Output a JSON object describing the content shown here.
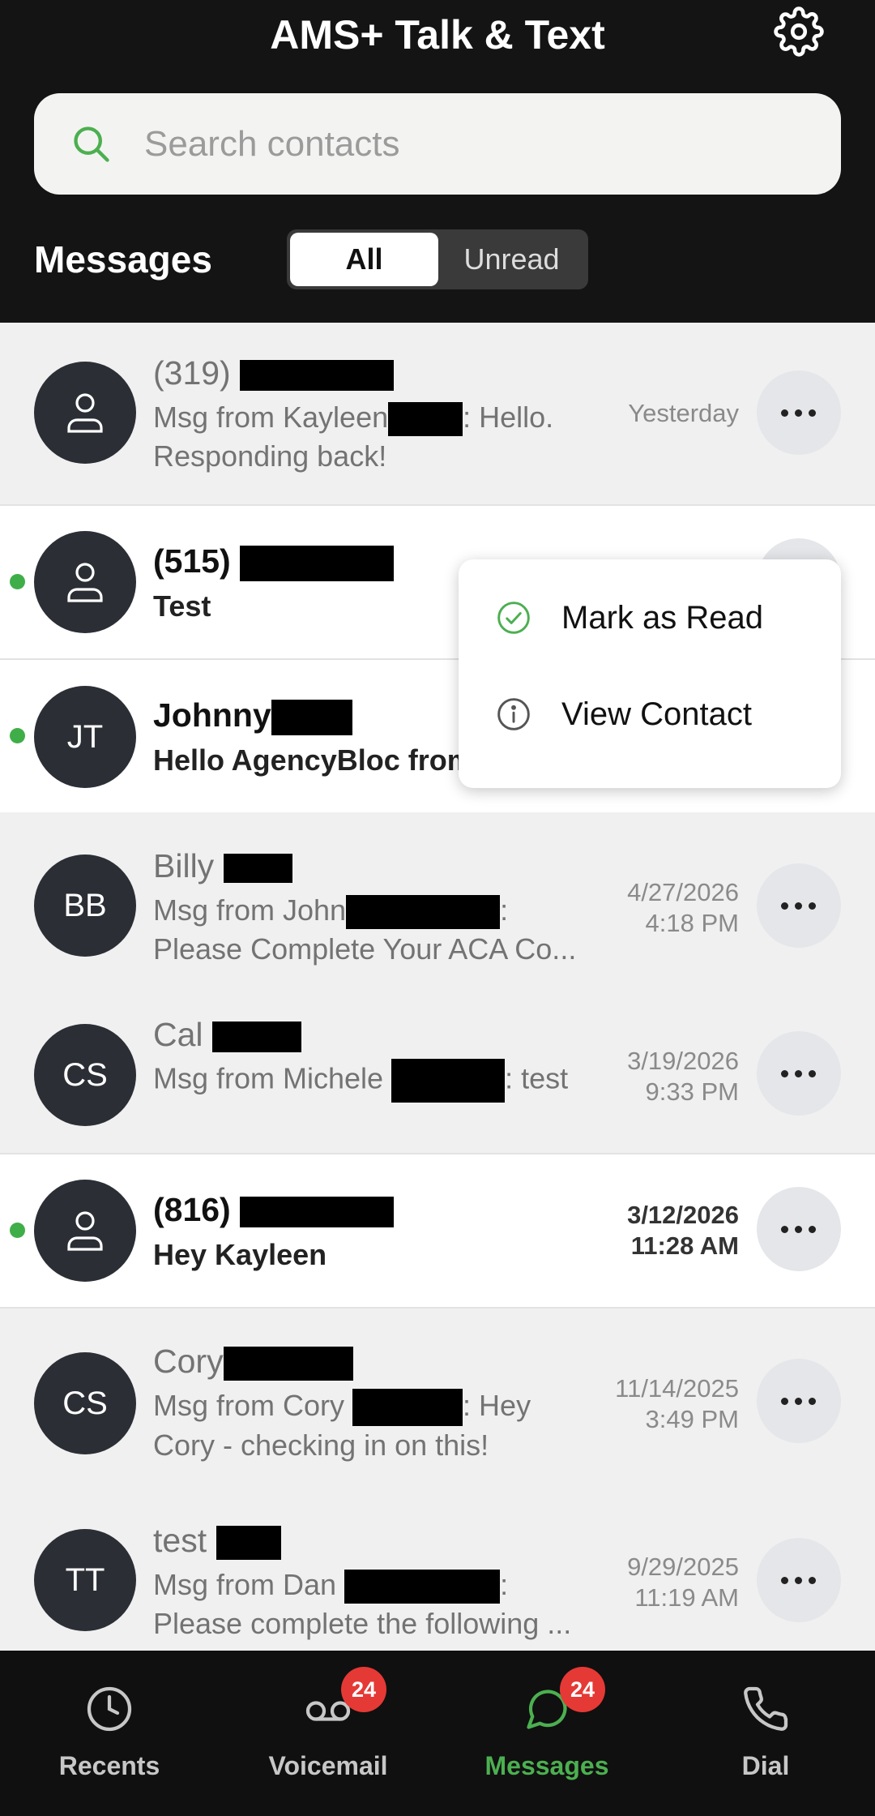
{
  "app": {
    "title": "AMS+ Talk & Text"
  },
  "search": {
    "placeholder": "Search contacts"
  },
  "section": {
    "title": "Messages"
  },
  "filter": {
    "all": "All",
    "unread": "Unread",
    "selected": "All"
  },
  "conversations": [
    {
      "name": "(319)",
      "avatar": "person-icon",
      "message": "Msg from Kayleen",
      "message_tail": ": Hello.",
      "message_line2": "Responding back!",
      "time": "Yesterday",
      "time2": "",
      "unread": false
    },
    {
      "name": "(515)",
      "avatar": "person-icon",
      "message": "Test",
      "time": "",
      "time2": "",
      "unread": true
    },
    {
      "name": "Johnny",
      "avatar": "JT",
      "message": "Hello AgencyBloc from",
      "time": "",
      "time2": "",
      "unread": true
    },
    {
      "name": "Billy",
      "avatar": "BB",
      "message": "Msg from John",
      "message_tail": ":",
      "message_line2": "Please Complete Your ACA Co...",
      "time": "4/27/2026",
      "time2": "4:18 PM",
      "unread": false
    },
    {
      "name": "Cal",
      "avatar": "CS",
      "message": "Msg from Michele",
      "message_tail": ": test",
      "time": "3/19/2026",
      "time2": "9:33 PM",
      "unread": false
    },
    {
      "name": "(816)",
      "avatar": "person-icon",
      "message": "Hey Kayleen",
      "time": "3/12/2026",
      "time2": "11:28 AM",
      "unread": true
    },
    {
      "name": "Cory",
      "avatar": "CS",
      "message": "Msg from Cory",
      "message_tail": ": Hey",
      "message_line2": "Cory - checking in on this!",
      "time": "11/14/2025",
      "time2": "3:49 PM",
      "unread": false
    },
    {
      "name": "test",
      "avatar": "TT",
      "message": "Msg from Dan",
      "message_tail": ":",
      "message_line2": "Please complete the following ...",
      "time": "9/29/2025",
      "time2": "11:19 AM",
      "unread": false
    }
  ],
  "context_menu": {
    "items": [
      {
        "label": "Mark as Read",
        "icon": "check-circle-icon"
      },
      {
        "label": "View Contact",
        "icon": "info-icon"
      }
    ]
  },
  "nav": {
    "items": [
      {
        "label": "Recents",
        "icon": "clock-icon",
        "badge": ""
      },
      {
        "label": "Voicemail",
        "icon": "voicemail-icon",
        "badge": "24"
      },
      {
        "label": "Messages",
        "icon": "chat-icon",
        "badge": "24",
        "active": true
      },
      {
        "label": "Dial",
        "icon": "phone-icon",
        "badge": ""
      }
    ]
  },
  "colors": {
    "accent": "#4caf50",
    "badge": "#e53935",
    "header": "#141414",
    "unread_dot": "#3fae49"
  }
}
